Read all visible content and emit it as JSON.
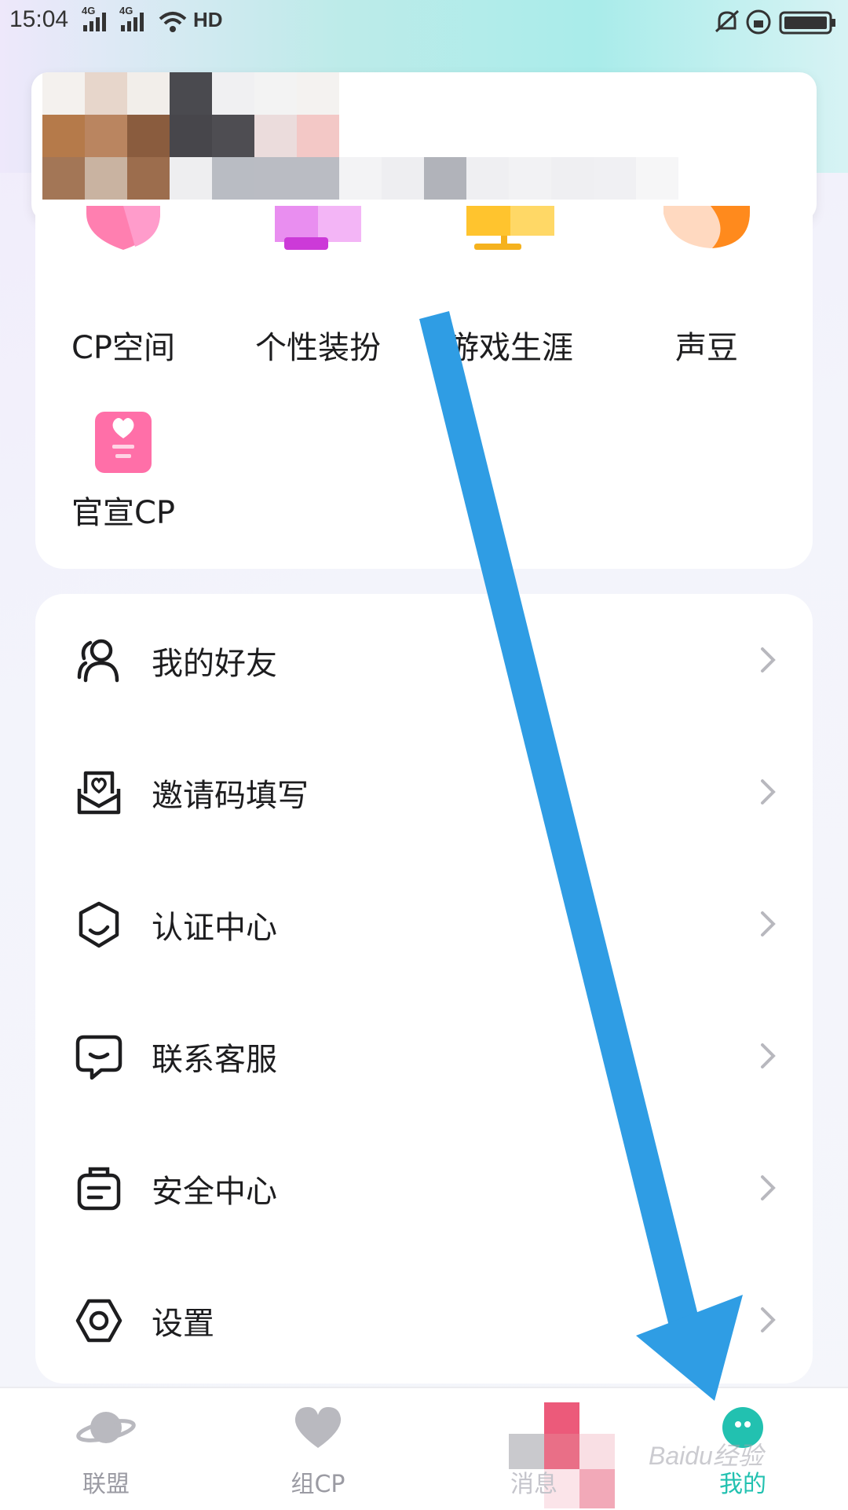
{
  "status_bar": {
    "time": "15:04",
    "network1": "4G",
    "network2": "4G",
    "hd": "HD"
  },
  "features": [
    {
      "label": "CP空间",
      "icon": "heart-gift-icon"
    },
    {
      "label": "个性装扮",
      "icon": "costume-icon"
    },
    {
      "label": "游戏生涯",
      "icon": "game-monitor-icon"
    },
    {
      "label": "声豆",
      "icon": "bean-icon"
    },
    {
      "label": "官宣CP",
      "icon": "heart-card-icon"
    }
  ],
  "menu": [
    {
      "label": "我的好友",
      "icon": "friends-icon"
    },
    {
      "label": "邀请码填写",
      "icon": "invite-mail-icon"
    },
    {
      "label": "认证中心",
      "icon": "certification-icon"
    },
    {
      "label": "联系客服",
      "icon": "customer-service-icon"
    },
    {
      "label": "安全中心",
      "icon": "security-icon"
    },
    {
      "label": "设置",
      "icon": "settings-icon"
    }
  ],
  "tabs": [
    {
      "label": "联盟",
      "icon": "planet-icon",
      "active": false
    },
    {
      "label": "组CP",
      "icon": "heart-icon",
      "active": false
    },
    {
      "label": "消息",
      "icon": "message-icon",
      "active": false
    },
    {
      "label": "我的",
      "icon": "profile-icon",
      "active": true
    }
  ],
  "watermark": "Baidu经验",
  "colors": {
    "accent": "#22c1b0",
    "arrow": "#2f9de4",
    "inactive_tab": "#9b9ba3"
  }
}
